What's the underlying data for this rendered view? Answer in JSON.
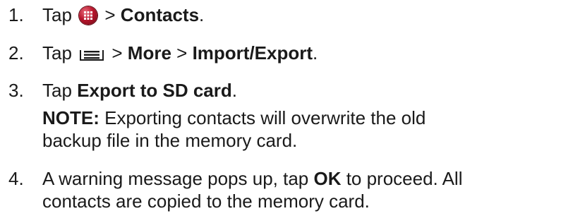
{
  "steps": [
    {
      "number": "1.",
      "pre": "Tap",
      "icon": "app-grid-icon",
      "mid": " > ",
      "bold": "Contacts",
      "post": "."
    },
    {
      "number": "2.",
      "pre": "Tap",
      "icon": "menu-icon",
      "mid": " > ",
      "bold1": "More",
      "mid2": " > ",
      "bold2": "Import/Export",
      "post": "."
    },
    {
      "number": "3.",
      "pre": "Tap ",
      "bold": "Export to SD card",
      "post": ".",
      "note_label": "NOTE:",
      "note_line1": " Exporting contacts will overwrite the old",
      "note_line2": "backup file in the memory card."
    },
    {
      "number": "4.",
      "pre": "A warning message pops up, tap ",
      "bold": "OK",
      "post": " to proceed. All",
      "line2": "contacts are copied to the memory card."
    }
  ]
}
